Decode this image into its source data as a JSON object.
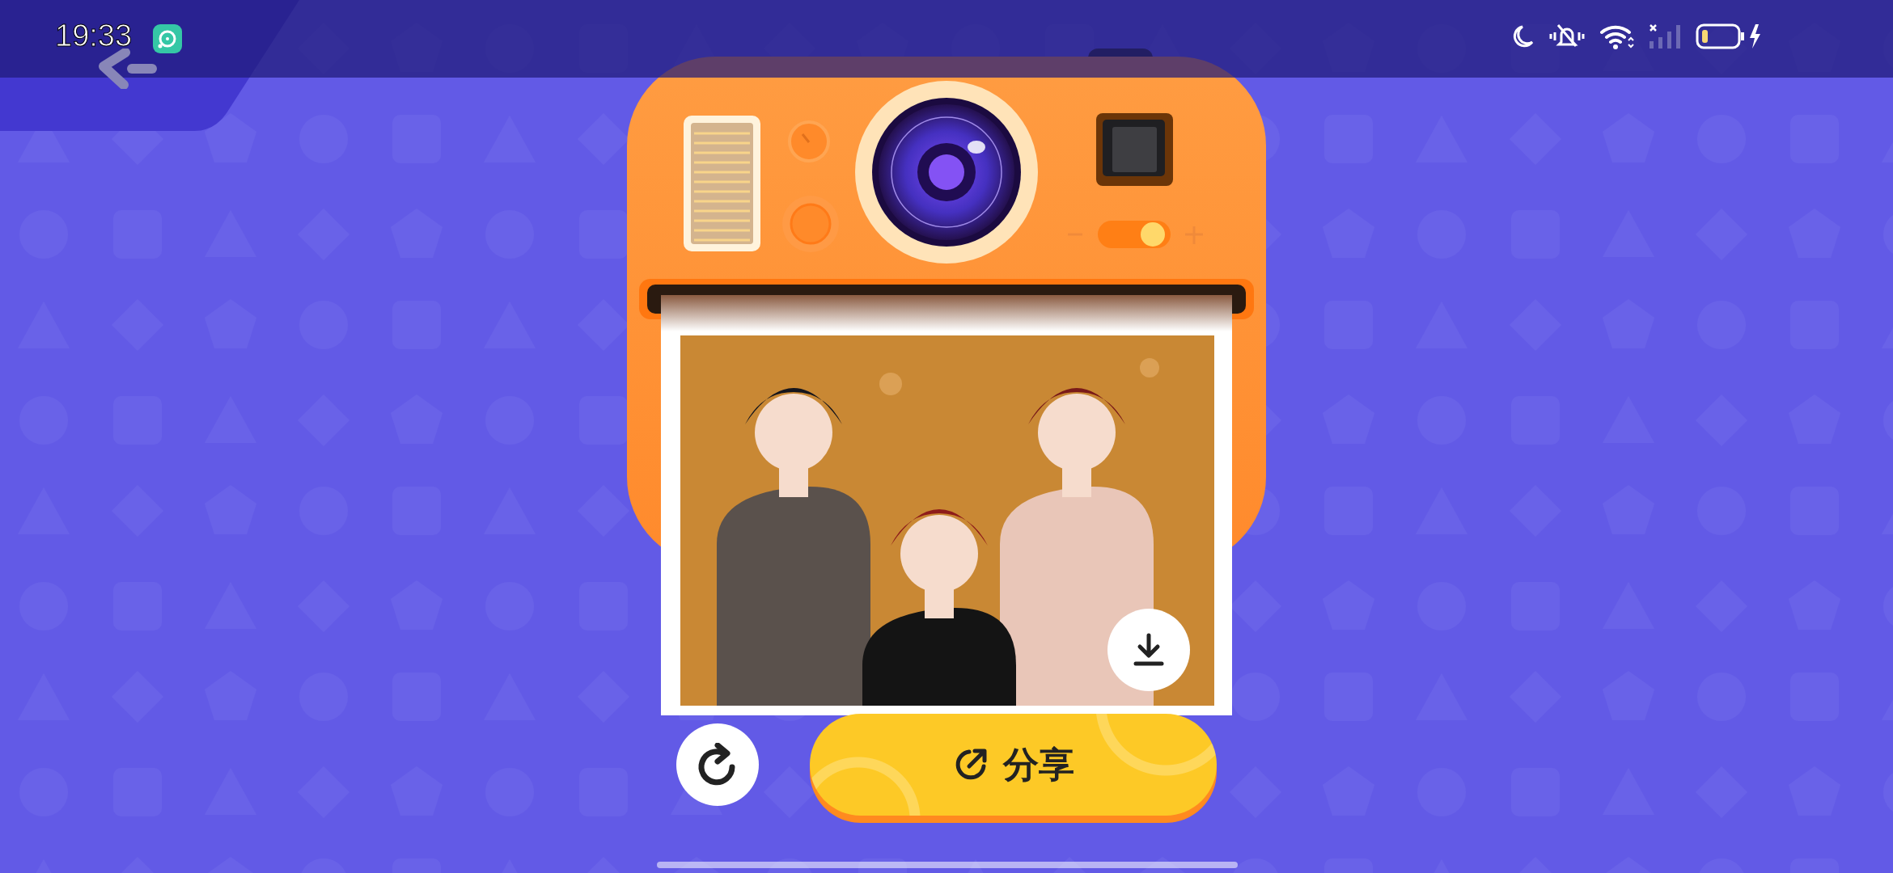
{
  "status_bar": {
    "time": "19:33"
  },
  "share_button": {
    "label": "分享"
  }
}
